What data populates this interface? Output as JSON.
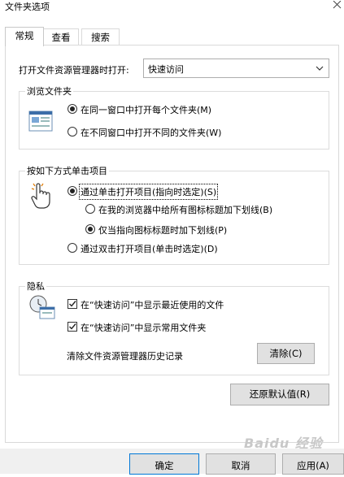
{
  "window": {
    "title": "文件夹选项"
  },
  "tabs": [
    {
      "label": "常规"
    },
    {
      "label": "查看"
    },
    {
      "label": "搜索"
    }
  ],
  "open_with": {
    "label": "打开文件资源管理器时打开:",
    "value": "快速访问"
  },
  "browse_folders": {
    "title": "浏览文件夹",
    "options": [
      {
        "label": "在同一窗口中打开每个文件夹(M)",
        "checked": true
      },
      {
        "label": "在不同窗口中打开不同的文件夹(W)",
        "checked": false
      }
    ]
  },
  "click_items": {
    "title": "按如下方式单击项目",
    "single_click": {
      "label": "通过单击打开项目(指向时选定)(S)",
      "checked": true
    },
    "underline_all": {
      "label": "在我的浏览器中给所有图标标题加下划线(B)",
      "checked": false
    },
    "underline_point": {
      "label": "仅当指向图标标题时加下划线(P)",
      "checked": true
    },
    "double_click": {
      "label": "通过双击打开项目(单击时选定)(D)",
      "checked": false
    }
  },
  "privacy": {
    "title": "隐私",
    "recent_files": {
      "label": "在“快速访问”中显示最近使用的文件",
      "checked": true
    },
    "frequent_folders": {
      "label": "在“快速访问”中显示常用文件夹",
      "checked": true
    },
    "clear_label": "清除文件资源管理器历史记录",
    "clear_button": "清除(C)"
  },
  "restore_button": "还原默认值(R)",
  "footer": {
    "ok": "确定",
    "cancel": "取消",
    "apply": "应用(A)"
  },
  "watermark": "Baidu 经验",
  "colors": {
    "accent": "#0078d7",
    "button_bg": "#e1e1e1",
    "border": "#adadad"
  }
}
